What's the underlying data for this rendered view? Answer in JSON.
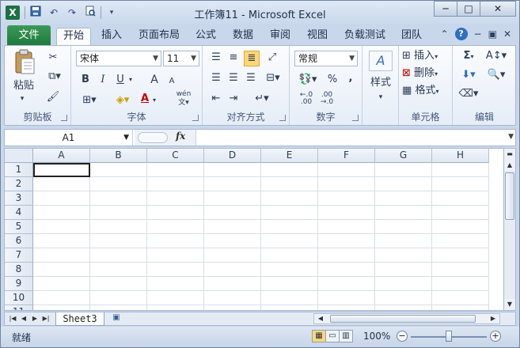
{
  "title": "工作簿11 - Microsoft Excel",
  "quick_access": [
    "save-icon",
    "undo-icon",
    "redo-icon",
    "print-preview-icon",
    "customize-icon"
  ],
  "window_controls": [
    "minimize",
    "maximize",
    "close"
  ],
  "tabs": {
    "file": "文件",
    "items": [
      "开始",
      "插入",
      "页面布局",
      "公式",
      "数据",
      "审阅",
      "视图",
      "负载测试",
      "团队"
    ]
  },
  "ribbon": {
    "clipboard": {
      "paste": "粘贴",
      "label": "剪贴板"
    },
    "font": {
      "name": "宋体",
      "size": "11",
      "label": "字体",
      "bold": "B",
      "italic": "I",
      "underline": "U",
      "grow": "A",
      "shrink": "A",
      "font_color": "A",
      "phonetic": "wén"
    },
    "alignment": {
      "label": "对齐方式"
    },
    "number": {
      "format": "常规",
      "percent": "%",
      "comma": ",",
      "label": "数字"
    },
    "styles": {
      "label": "样式"
    },
    "cells": {
      "insert": "插入",
      "delete": "删除",
      "format": "格式",
      "label": "单元格"
    },
    "editing": {
      "label": "编辑",
      "sum": "Σ"
    }
  },
  "formula_bar": {
    "name_box": "A1",
    "fx": "fx",
    "content": ""
  },
  "grid": {
    "columns": [
      "A",
      "B",
      "C",
      "D",
      "E",
      "F",
      "G",
      "H"
    ],
    "rows": [
      "1",
      "2",
      "3",
      "4",
      "5",
      "6",
      "7",
      "8",
      "9",
      "10",
      "11"
    ]
  },
  "sheets": [
    "Sheet3"
  ],
  "status": {
    "ready": "就绪",
    "zoom": "100%"
  },
  "colors": {
    "file_tab": "#1f7a3d",
    "accent": "#2f6fc3"
  }
}
